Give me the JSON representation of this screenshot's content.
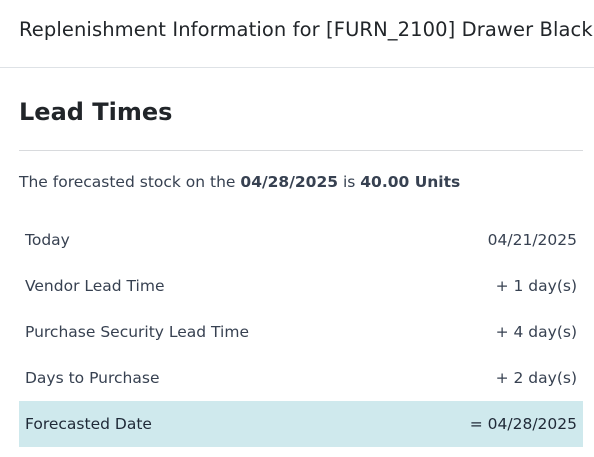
{
  "header": {
    "title": "Replenishment Information for [FURN_2100] Drawer Black"
  },
  "section": {
    "title": "Lead Times"
  },
  "forecast": {
    "prefix": "The forecasted stock on the ",
    "date": "04/28/2025",
    "middle": " is ",
    "quantity": "40.00 Units"
  },
  "rows": [
    {
      "label": "Today",
      "value": "04/21/2025"
    },
    {
      "label": "Vendor Lead Time",
      "value": "+ 1 day(s)"
    },
    {
      "label": "Purchase Security Lead Time",
      "value": "+ 4 day(s)"
    },
    {
      "label": "Days to Purchase",
      "value": "+ 2 day(s)"
    },
    {
      "label": "Forecasted Date",
      "value": "= 04/28/2025"
    }
  ],
  "colors": {
    "highlight_row": "#cfe9ed"
  }
}
